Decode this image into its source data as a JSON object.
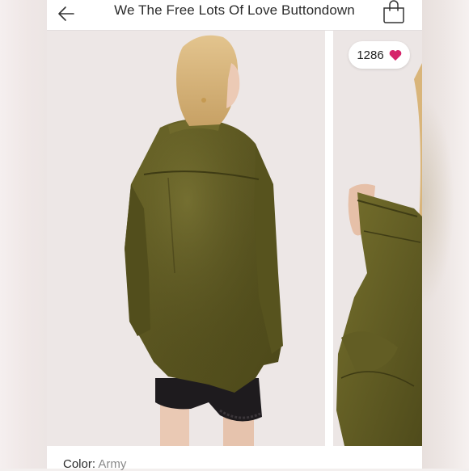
{
  "header": {
    "title": "We The Free Lots Of Love Buttondown"
  },
  "likes": {
    "count": "1286"
  },
  "details": {
    "color_label": "Color:",
    "color_value": "Army"
  },
  "colors": {
    "heart": "#d5246a",
    "garment": "#5e5a22"
  },
  "icons": {
    "back": "arrow-left-icon",
    "bag": "shopping-bag-icon",
    "heart": "heart-icon"
  }
}
